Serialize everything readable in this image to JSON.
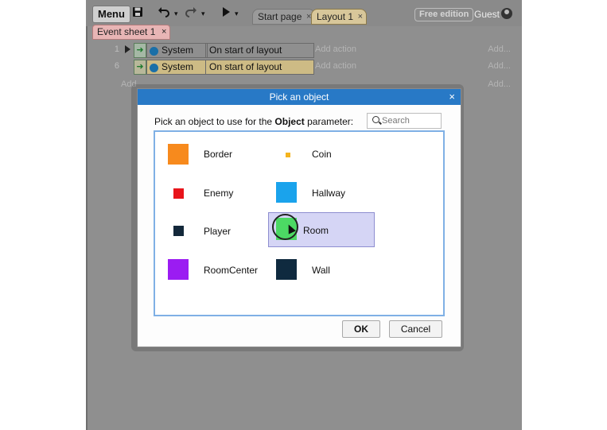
{
  "toolbar": {
    "menu_label": "Menu",
    "tabs": [
      {
        "label": "Start page",
        "close": "×"
      },
      {
        "label": "Layout 1",
        "close": "×"
      }
    ],
    "edition_badge": "Free edition",
    "user_name": "Guest"
  },
  "event_sheet_tab": {
    "label": "Event sheet 1",
    "close": "×"
  },
  "events": [
    {
      "number": "1",
      "object": "System",
      "condition": "On start of layout",
      "add_action": "Add action",
      "add_right": "Add..."
    },
    {
      "number": "6",
      "object": "System",
      "condition": "On start of layout",
      "add_action": "Add action",
      "add_right": "Add..."
    }
  ],
  "add_below_left": "Add",
  "add_below_right": "Add...",
  "dialog": {
    "title": "Pick an object",
    "close": "×",
    "prompt_pre": "Pick an object to use for the ",
    "prompt_bold": "Object",
    "prompt_post": " parameter:",
    "search_placeholder": "Search",
    "objects": [
      {
        "name": "Border",
        "color": "#f78a1d"
      },
      {
        "name": "Coin",
        "color": "#f5b41e"
      },
      {
        "name": "Enemy",
        "color": "#e8141b"
      },
      {
        "name": "Hallway",
        "color": "#1aa3ec"
      },
      {
        "name": "Player",
        "color": "#13283a"
      },
      {
        "name": "Room",
        "color": "#4cd964"
      },
      {
        "name": "RoomCenter",
        "color": "#9b1cf2"
      },
      {
        "name": "Wall",
        "color": "#0f2a3f"
      }
    ],
    "selected": "Room",
    "ok_label": "OK",
    "cancel_label": "Cancel"
  }
}
